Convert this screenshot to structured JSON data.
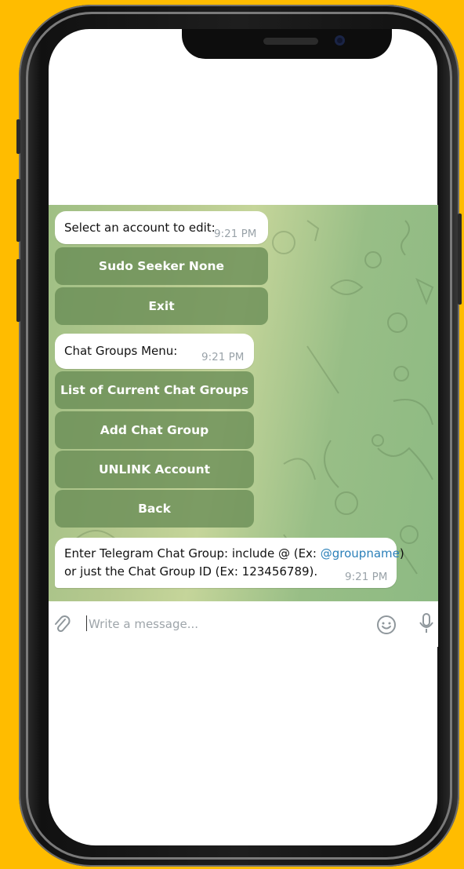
{
  "chat": {
    "msg1": {
      "text": "Select an account to edit:",
      "time": "9:21 PM"
    },
    "kb1": [
      "Sudo Seeker None",
      "Exit"
    ],
    "msg2": {
      "text": "Chat Groups Menu:",
      "time": "9:21 PM"
    },
    "kb2": [
      "List of Current Chat Groups",
      "Add Chat Group",
      "UNLINK Account",
      "Back"
    ],
    "msg3": {
      "line1_prefix": "Enter Telegram Chat Group: include @ (Ex: ",
      "link": "@groupname",
      "line1_suffix": ")",
      "line2": "or just the Chat Group ID (Ex: 123456789).",
      "time": "9:21 PM"
    }
  },
  "composer": {
    "placeholder": "Write a message..."
  },
  "icons": {
    "attach": "paperclip-icon",
    "emoji": "smiley-icon",
    "voice": "microphone-icon",
    "link_color": "#2b80b9",
    "button_color": "#688c54",
    "background_color": "#FFBC00"
  }
}
